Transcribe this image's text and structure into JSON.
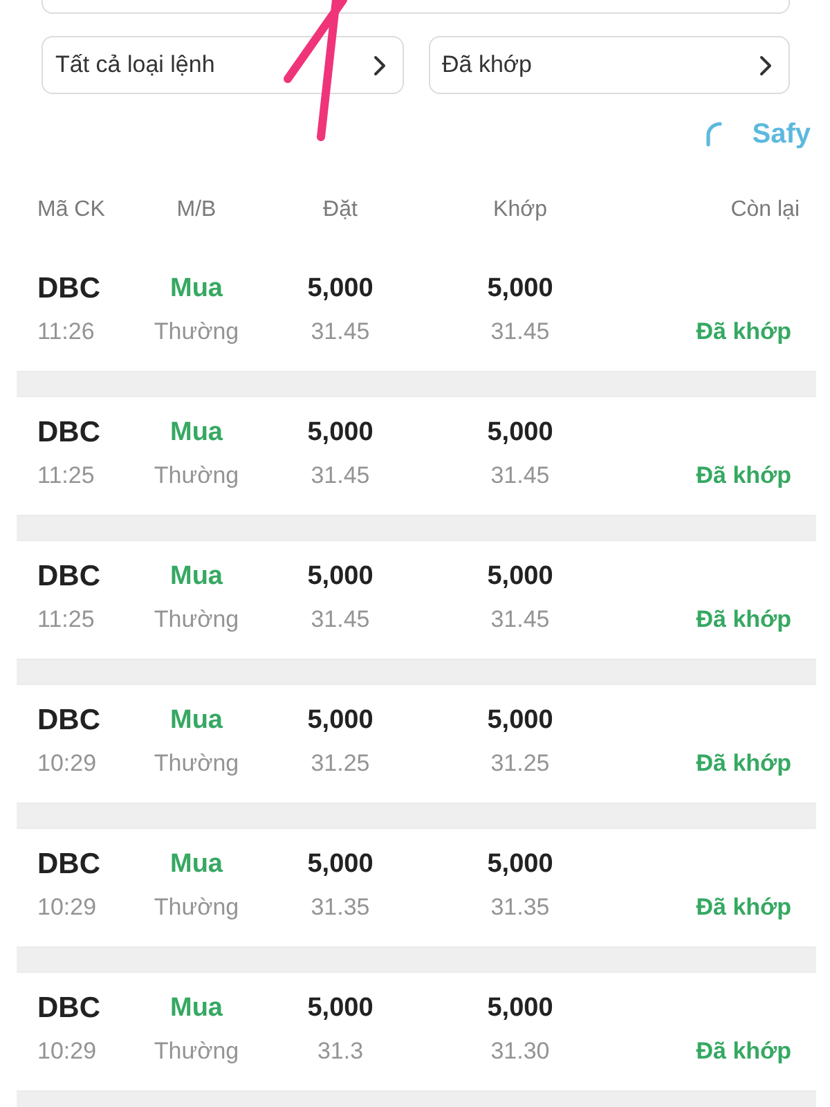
{
  "filters": [
    {
      "value": "Tất cả loại lệnh"
    },
    {
      "value": "Đã khớp"
    }
  ],
  "brand": {
    "name": "Safy"
  },
  "table": {
    "columns": [
      "Mã CK",
      "M/B",
      "Đặt",
      "Khớp",
      "Còn lại"
    ],
    "rows": [
      {
        "symbol": "DBC",
        "time": "11:26",
        "side": "Mua",
        "order_type": "Thường",
        "ordered_qty": "5,000",
        "ordered_price": "31.45",
        "matched_qty": "5,000",
        "matched_price": "31.45",
        "status": "Đã khớp"
      },
      {
        "symbol": "DBC",
        "time": "11:25",
        "side": "Mua",
        "order_type": "Thường",
        "ordered_qty": "5,000",
        "ordered_price": "31.45",
        "matched_qty": "5,000",
        "matched_price": "31.45",
        "status": "Đã khớp"
      },
      {
        "symbol": "DBC",
        "time": "11:25",
        "side": "Mua",
        "order_type": "Thường",
        "ordered_qty": "5,000",
        "ordered_price": "31.45",
        "matched_qty": "5,000",
        "matched_price": "31.45",
        "status": "Đã khớp"
      },
      {
        "symbol": "DBC",
        "time": "10:29",
        "side": "Mua",
        "order_type": "Thường",
        "ordered_qty": "5,000",
        "ordered_price": "31.25",
        "matched_qty": "5,000",
        "matched_price": "31.25",
        "status": "Đã khớp"
      },
      {
        "symbol": "DBC",
        "time": "10:29",
        "side": "Mua",
        "order_type": "Thường",
        "ordered_qty": "5,000",
        "ordered_price": "31.35",
        "matched_qty": "5,000",
        "matched_price": "31.35",
        "status": "Đã khớp"
      },
      {
        "symbol": "DBC",
        "time": "10:29",
        "side": "Mua",
        "order_type": "Thường",
        "ordered_qty": "5,000",
        "ordered_price": "31.3",
        "matched_qty": "5,000",
        "matched_price": "31.30",
        "status": "Đã khớp"
      }
    ]
  }
}
